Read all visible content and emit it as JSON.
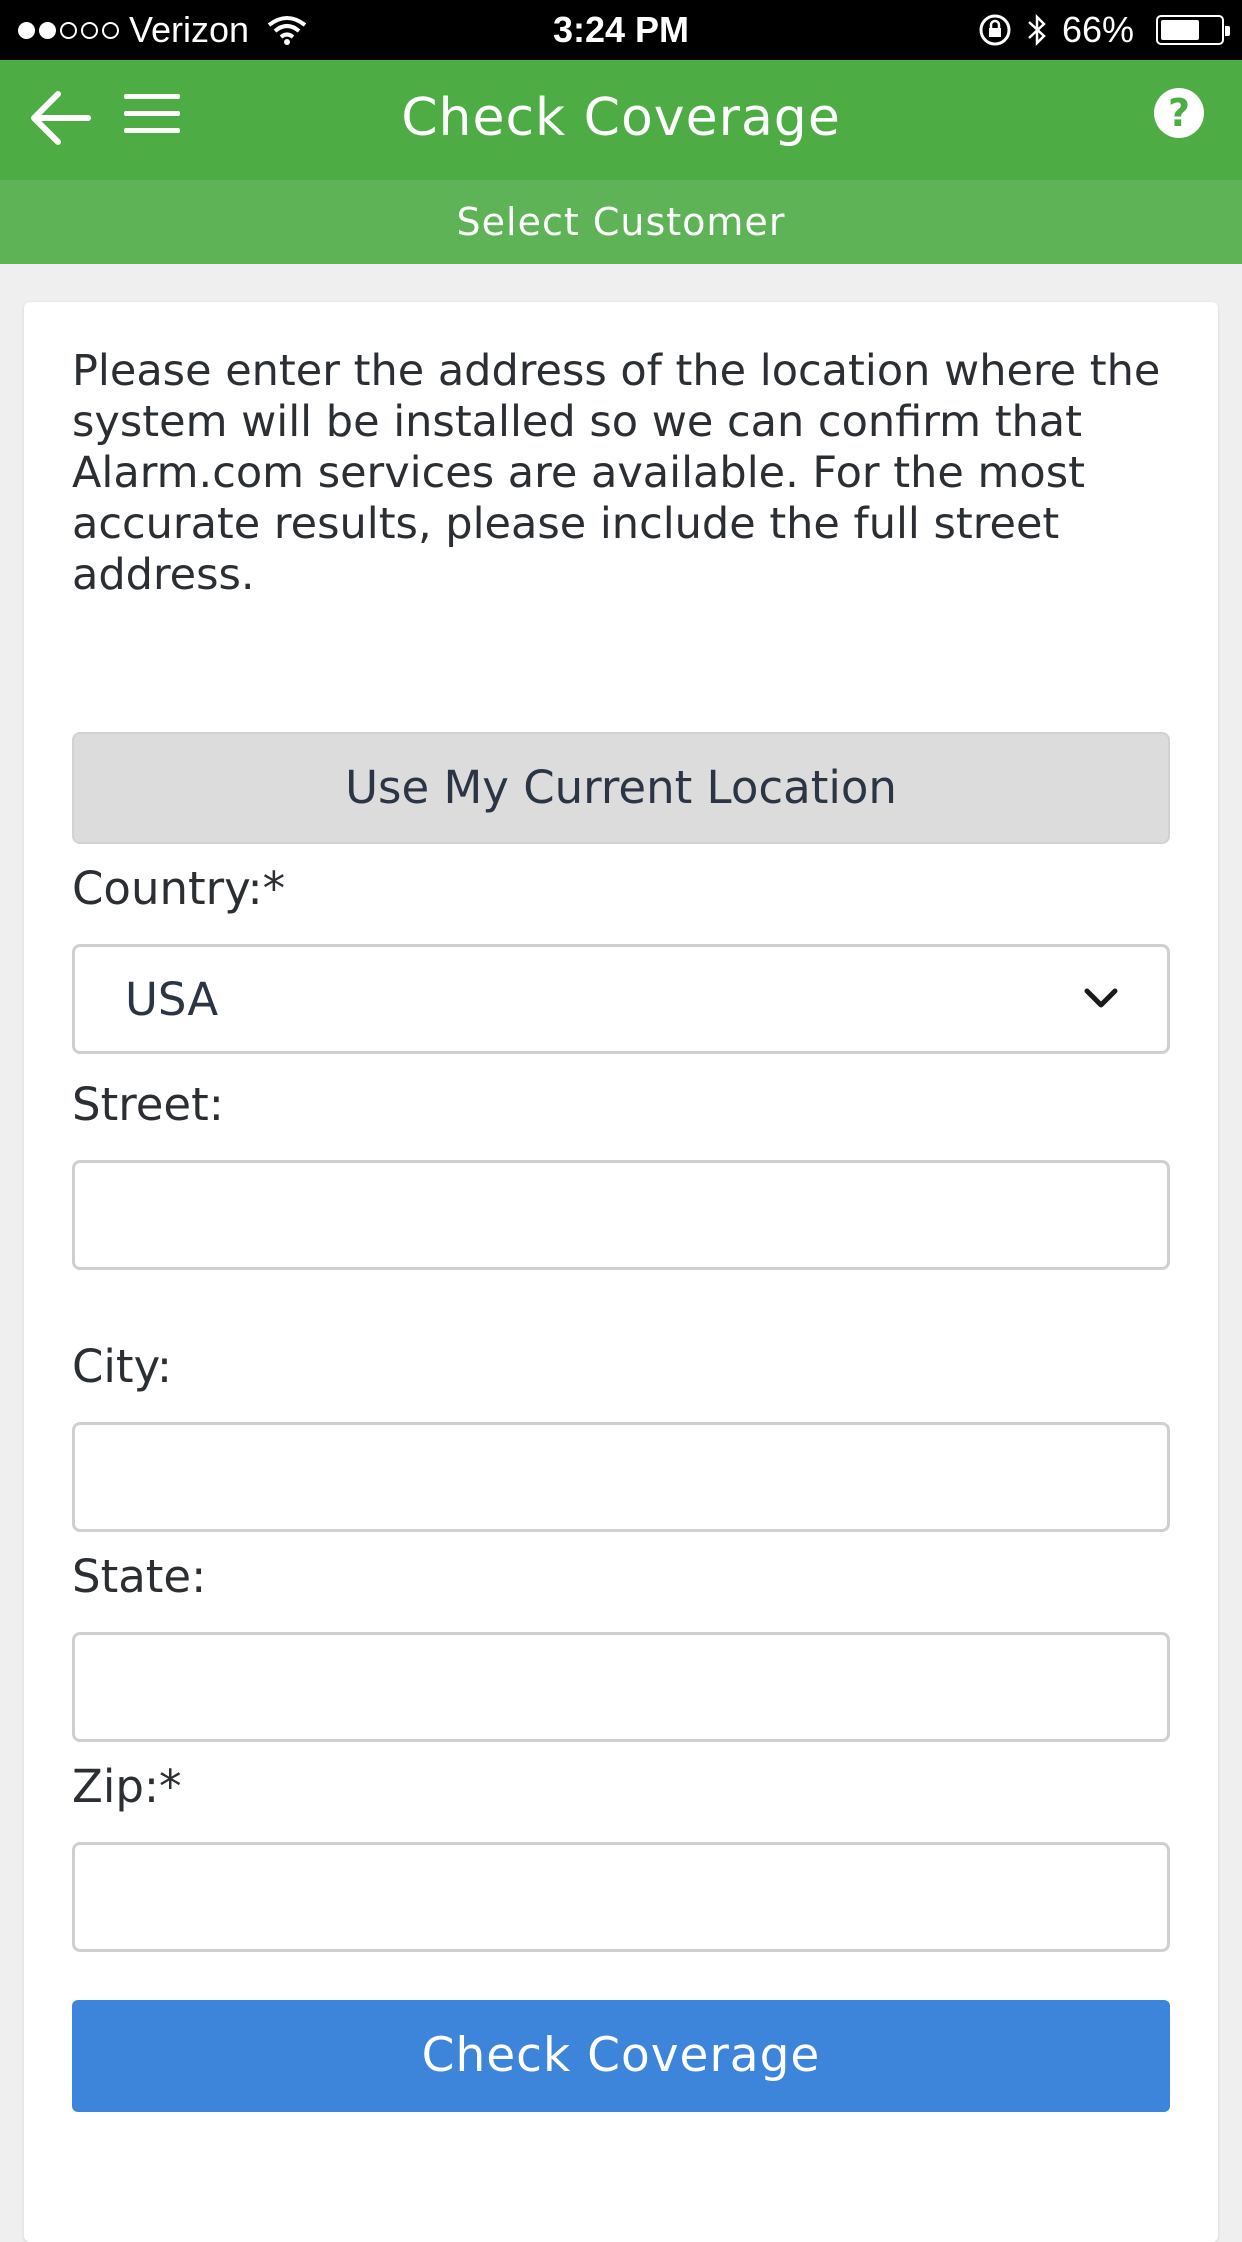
{
  "status_bar": {
    "carrier": "Verizon",
    "signal_bars_filled": 2,
    "signal_bars_total": 5,
    "time": "3:24 PM",
    "battery_percent": "66%",
    "battery_level": 0.66
  },
  "header": {
    "title": "Check Coverage",
    "help_label": "?",
    "subheader": "Select Customer",
    "color": "#4dac44"
  },
  "form": {
    "intro_text": "Please enter the address of the location where the system will be installed so we can confirm that Alarm.com services are available. For the most accurate results, please include the full street address.",
    "use_location_label": "Use My Current Location",
    "country_label": "Country:*",
    "country_value": "USA",
    "street_label": "Street:",
    "street_value": "",
    "city_label": "City:",
    "city_value": "",
    "state_label": "State:",
    "state_value": "",
    "zip_label": "Zip:*",
    "zip_value": "",
    "submit_label": "Check Coverage",
    "submit_color": "#3c85db"
  }
}
